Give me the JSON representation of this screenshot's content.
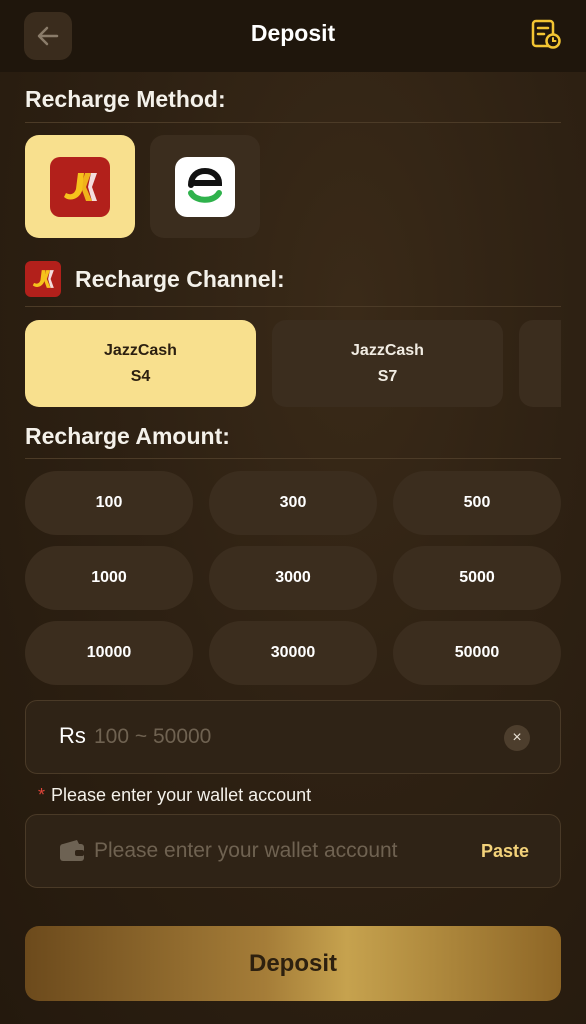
{
  "header": {
    "title": "Deposit",
    "back_icon": "arrow-left-icon",
    "history_icon": "order-history-icon"
  },
  "recharge_method": {
    "title": "Recharge Method:",
    "methods": [
      {
        "icon": "jazzcash-logo-icon",
        "selected": true
      },
      {
        "icon": "easypaisa-logo-icon",
        "selected": false
      }
    ]
  },
  "recharge_channel": {
    "title": "Recharge Channel:",
    "channels": [
      {
        "name": "JazzCash",
        "code": "S4",
        "selected": true
      },
      {
        "name": "JazzCash",
        "code": "S7",
        "selected": false
      }
    ]
  },
  "recharge_amount": {
    "title": "Recharge Amount:",
    "options": [
      "100",
      "300",
      "500",
      "1000",
      "3000",
      "5000",
      "10000",
      "30000",
      "50000"
    ],
    "currency": "Rs",
    "placeholder": "100 ~ 50000",
    "value": "",
    "clear_symbol": "×"
  },
  "wallet": {
    "required_mark": "*",
    "label": "Please enter your wallet account",
    "placeholder": "Please enter your wallet account",
    "value": "",
    "paste_label": "Paste"
  },
  "deposit_button": {
    "label": "Deposit"
  },
  "colors": {
    "accent": "#f8e08e",
    "background": "#2e2113",
    "card": "#3b2d1e",
    "paste": "#f3d27a",
    "required": "#e0453a"
  }
}
